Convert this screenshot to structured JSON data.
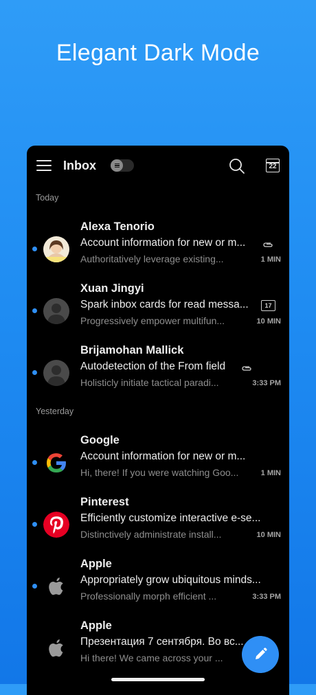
{
  "promo": {
    "title": "Elegant Dark Mode"
  },
  "header": {
    "title": "Inbox",
    "calendar_day": "22"
  },
  "sections": {
    "today": "Today",
    "yesterday": "Yesterday"
  },
  "emails": [
    {
      "sender": "Alexa Tenorio",
      "subject": "Account information for new or m...",
      "preview": "Authoritatively leverage existing...",
      "time": "1 MIN",
      "unread": true,
      "icon": "paperclip-icon"
    },
    {
      "sender": "Xuan Jingyi",
      "subject": "Spark inbox cards for read messa...",
      "preview": "Progressively empower multifun...",
      "time": "10 MIN",
      "unread": true,
      "icon": "calendar-badge-icon",
      "badge": "17"
    },
    {
      "sender": "Brijamohan Mallick",
      "subject": "Autodetection of the From field",
      "preview": "Holisticly initiate tactical paradi...",
      "time": "3:33 PM",
      "unread": true,
      "icon": "paperclip-icon"
    },
    {
      "sender": "Google",
      "subject": "Account information for new or m...",
      "preview": "Hi, there! If you were watching Goo...",
      "time": "1 MIN",
      "unread": true
    },
    {
      "sender": "Pinterest",
      "subject": "Efficiently customize interactive e-se...",
      "preview": "Distinctively administrate install...",
      "time": "10 MIN",
      "unread": true
    },
    {
      "sender": "Apple",
      "subject": "Appropriately grow ubiquitous minds...",
      "preview": "Professionally morph efficient ...",
      "time": "3:33 PM",
      "unread": true
    },
    {
      "sender": "Apple",
      "subject": "Презентация 7 сентября. Во вс...",
      "preview": "Hi there! We came across your ...",
      "time": "",
      "unread": false
    }
  ],
  "colors": {
    "accent": "#2f8ff5",
    "background": "#000000",
    "promo_bg": "#2f9cf7"
  }
}
